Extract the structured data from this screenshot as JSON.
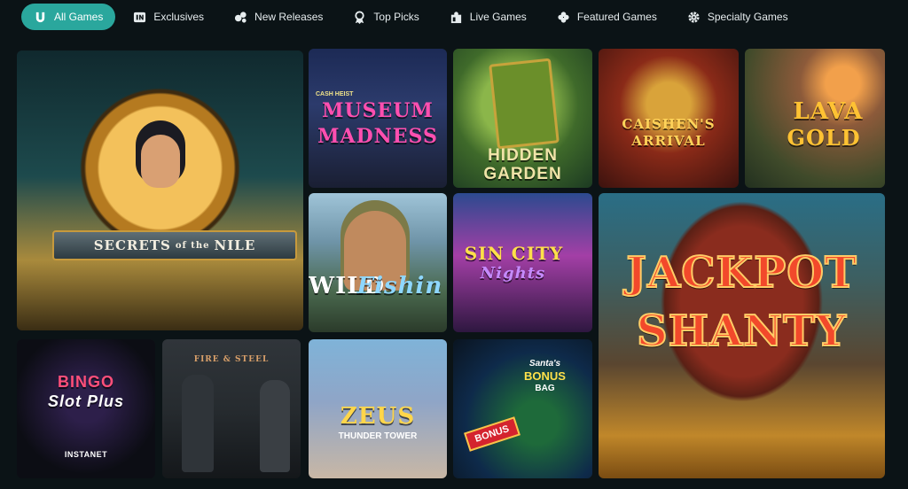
{
  "nav": {
    "tabs": [
      {
        "label": "All Games",
        "icon": "horseshoe-icon",
        "active": true
      },
      {
        "label": "Exclusives",
        "icon": "exclusive-badge-icon",
        "active": false
      },
      {
        "label": "New Releases",
        "icon": "new-releases-icon",
        "active": false
      },
      {
        "label": "Top Picks",
        "icon": "trophy-icon",
        "active": false
      },
      {
        "label": "Live Games",
        "icon": "live-dealer-icon",
        "active": false
      },
      {
        "label": "Featured Games",
        "icon": "clover-icon",
        "active": false
      },
      {
        "label": "Specialty Games",
        "icon": "gear-icon",
        "active": false
      }
    ],
    "active_color": "#2aa79d"
  },
  "games": {
    "nile": {
      "title_a": "SECRETS",
      "title_b": "of the",
      "title_c": "NILE"
    },
    "museum": {
      "line0": "CASH HEIST",
      "line1": "MUSEUM",
      "line2": "MADNESS"
    },
    "garden": {
      "line1": "HIDDEN",
      "line2": "GARDEN"
    },
    "caishen": {
      "line1": "CAISHEN'S",
      "line2": "ARRIVAL"
    },
    "lava": {
      "line1": "LAVA",
      "line2": "GOLD"
    },
    "fishin": {
      "line1": "WILD",
      "line2": "Fishin"
    },
    "sincity": {
      "line1": "SIN CITY",
      "line2": "Nights"
    },
    "jackpot": {
      "line1": "JACKPOT",
      "line2": "SHANTY"
    },
    "bingo": {
      "line1": "BINGO",
      "line2": "Slot Plus",
      "provider": "INSTANET"
    },
    "fire": {
      "line1": "FIRE & STEEL"
    },
    "zeus": {
      "line1": "ZEUS",
      "line2": "THUNDER TOWER"
    },
    "santa": {
      "line1": "Santa's",
      "line2": "BONUS",
      "line3": "BAG",
      "badge": "BONUS"
    }
  }
}
